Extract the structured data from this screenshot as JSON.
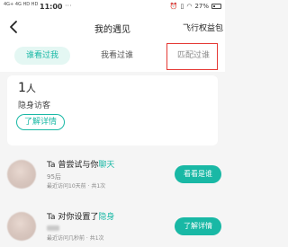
{
  "status_bar": {
    "signal_text": "4G+ 4G HD HD",
    "time": "11:00",
    "battery": "27%"
  },
  "header": {
    "title": "我的遇见",
    "right_label": "飞行权益包"
  },
  "tabs": [
    {
      "label": "谁看过我"
    },
    {
      "label": "我看过谁"
    },
    {
      "label": "匹配过谁"
    }
  ],
  "visitor_card": {
    "count": "1",
    "count_unit": "人",
    "label": "隐身访客",
    "button_label": "了解详情"
  },
  "list": [
    {
      "title_prefix": "Ta 曾尝试与你",
      "title_accent": "聊天",
      "sub": "95后",
      "meta": "最近访问10天前 · 共1次",
      "action": "看看是谁"
    },
    {
      "title_prefix": "Ta 对你设置了",
      "title_accent": "隐身",
      "sub": "",
      "meta": "最近访问几秒前 · 共1次",
      "action": "了解详情"
    }
  ],
  "colors": {
    "accent": "#19b8a5",
    "highlight_box": "#e53935"
  }
}
